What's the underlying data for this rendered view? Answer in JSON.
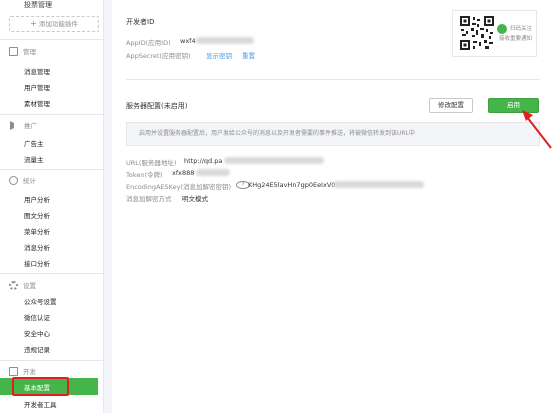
{
  "sidebar": {
    "top_item": "投票管理",
    "add_plugin": "添加功能插件",
    "groups": [
      {
        "title": "管理",
        "icon": "mail-icon",
        "items": [
          "消息管理",
          "用户管理",
          "素材管理"
        ]
      },
      {
        "title": "推广",
        "icon": "speaker-icon",
        "items": [
          "广告主",
          "流量主"
        ]
      },
      {
        "title": "统计",
        "icon": "pie-chart-icon",
        "items": [
          "用户分析",
          "图文分析",
          "菜单分析",
          "消息分析",
          "接口分析"
        ]
      },
      {
        "title": "设置",
        "icon": "gear-icon",
        "items": [
          "公众号设置",
          "微信认证",
          "安全中心",
          "违规记录"
        ]
      },
      {
        "title": "开发",
        "icon": "dev-icon",
        "items": [
          "基本配置",
          "开发者工具"
        ]
      }
    ],
    "active_item": "基本配置"
  },
  "developer": {
    "section_title": "开发者ID",
    "appid_label": "AppID(应用ID)",
    "appid_value": "wxf4",
    "secret_label": "AppSecret(应用密钥)",
    "show_key_link": "显示密钥",
    "reset_link": "重置"
  },
  "qr": {
    "line1": "扫码关注",
    "line2": "接收重要通知"
  },
  "server": {
    "title": "服务器配置(未启用)",
    "modify_button": "修改配置",
    "enable_button": "启用",
    "notice": "启用并设置服务器配置后，用户发给公众号的消息以及开发者需要的事件推送，将被微信转发到该URL中",
    "fields": [
      {
        "label": "URL(服务器地址)",
        "value": "http://qd.pa"
      },
      {
        "label": "Token(令牌)",
        "value": "xfx888"
      },
      {
        "label": "EncodingAESKey(消息加解密密钥)",
        "value": "KHg24E5lavHn7gp0EeIxV0"
      },
      {
        "label": "消息加解密方式",
        "value": "明文模式"
      }
    ]
  },
  "colors": {
    "accent_green": "#44b549",
    "link_blue": "#459ae9",
    "annotation_red": "#e02020"
  }
}
